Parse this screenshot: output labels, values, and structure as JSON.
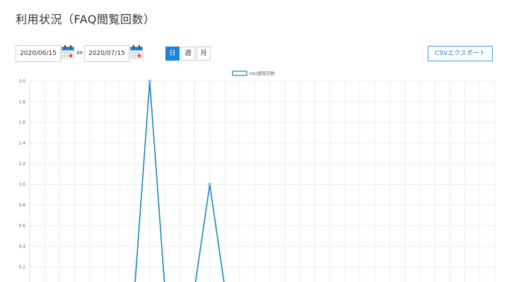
{
  "page": {
    "title": "利用状況（FAQ閲覧回数）"
  },
  "filters": {
    "start_date": "2020/06/15",
    "end_date": "2020/07/15",
    "range_arrow": "⇔",
    "period_buttons": [
      {
        "label": "日",
        "active": true
      },
      {
        "label": "週",
        "active": false
      },
      {
        "label": "月",
        "active": false
      }
    ],
    "csv_button": "CSVエクスポート"
  },
  "colors": {
    "accent": "#1787d6",
    "line": "#1f86b8"
  },
  "chart_data": {
    "type": "line",
    "series": [
      {
        "name": "FAQ閲覧回数",
        "values": [
          0,
          0,
          0,
          0,
          0,
          0,
          0,
          0,
          2,
          0,
          0,
          0,
          1,
          0,
          0,
          0,
          0,
          0,
          0,
          0,
          0,
          0,
          0,
          0,
          0,
          0,
          0,
          0,
          0,
          0,
          0,
          0
        ]
      }
    ],
    "y_ticks": [
      "2.0",
      "1.8",
      "1.6",
      "1.4",
      "1.2",
      "1.0",
      "0.8",
      "0.6",
      "0.4",
      "0.2"
    ],
    "ylim": [
      0,
      2
    ],
    "grid": true,
    "legend": "top-center"
  }
}
